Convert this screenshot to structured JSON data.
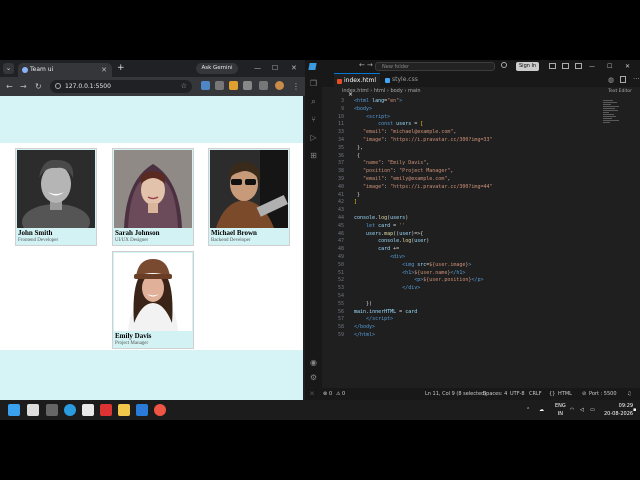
{
  "browser": {
    "tab_title": "Team ui",
    "new_tab": "+",
    "gemini_label": "Ask Gemini",
    "address": "127.0.0.1:5500",
    "minimize": "—",
    "maximize": "☐",
    "close": "✕"
  },
  "cards": [
    {
      "name": "John Smith",
      "position": "Frontend Developer"
    },
    {
      "name": "Sarah Johnson",
      "position": "UI/UX Designer"
    },
    {
      "name": "Michael Brown",
      "position": "Backend Developer"
    },
    {
      "name": "Emily Davis",
      "position": "Project Manager"
    }
  ],
  "vscode": {
    "search_placeholder": "New folder",
    "sign_in": "Sign In",
    "tabs": [
      {
        "label": "index.html",
        "close": "×"
      },
      {
        "label": "style.css"
      }
    ],
    "breadcrumb": [
      "index.html",
      "html",
      "body",
      "main"
    ],
    "text_editor_label": "Text Editor",
    "code_lines": [
      {
        "n": "3",
        "html": "<span class='tg'>&lt;html</span> <span class='at'>lang</span>=<span class='st'>\"en\"</span><span class='tg'>&gt;</span>"
      },
      {
        "n": "9",
        "html": "<span class='tg'>&lt;body&gt;</span>"
      },
      {
        "n": "10",
        "html": "    <span class='tg'>&lt;script&gt;</span>"
      },
      {
        "n": "11",
        "html": "        <span class='kw'>const</span> <span class='at'>users</span> = <span class='pu'>[</span>"
      },
      {
        "n": "33",
        "html": "   <span class='st'>\"email\"</span>: <span class='st'>\"michael@example.com\"</span>,"
      },
      {
        "n": "34",
        "html": "   <span class='st'>\"image\"</span>: <span class='st'>\"https://i.pravatar.cc/300?img=33\"</span>"
      },
      {
        "n": "35",
        "html": " },"
      },
      {
        "n": "36",
        "html": " {"
      },
      {
        "n": "37",
        "html": "   <span class='st'>\"name\"</span>: <span class='st'>\"Emily Davis\"</span>,"
      },
      {
        "n": "38",
        "html": "   <span class='st'>\"position\"</span>: <span class='st'>\"Project Manager\"</span>,"
      },
      {
        "n": "39",
        "html": "   <span class='st'>\"email\"</span>: <span class='st'>\"emily@example.com\"</span>,"
      },
      {
        "n": "40",
        "html": "   <span class='st'>\"image\"</span>: <span class='st'>\"https://i.pravatar.cc/300?img=44\"</span>"
      },
      {
        "n": "41",
        "html": " }"
      },
      {
        "n": "42",
        "html": "<span class='pu'>]</span>"
      },
      {
        "n": "43",
        "html": ""
      },
      {
        "n": "44",
        "html": "<span class='at'>console</span>.<span class='fn'>log</span>(<span class='at'>users</span>)"
      },
      {
        "n": "45",
        "html": "    <span class='kw'>let</span> <span class='at'>card</span> = <span class='st'>''</span>"
      },
      {
        "n": "46",
        "html": "    <span class='at'>users</span>.<span class='fn'>map</span>((<span class='at'>user</span>)=&gt;{"
      },
      {
        "n": "47",
        "html": "        <span class='at'>console</span>.<span class='fn'>log</span>(<span class='at'>user</span>)"
      },
      {
        "n": "48",
        "html": "        <span class='at'>card</span> +="
      },
      {
        "n": "49",
        "html": "            <span class='tg'>&lt;div&gt;</span>"
      },
      {
        "n": "50",
        "html": "                <span class='tg'>&lt;img</span> <span class='at'>src</span>=<span class='st'>${user.image}</span><span class='tg'>&gt;</span>"
      },
      {
        "n": "51",
        "html": "                <span class='tg'>&lt;h1&gt;</span><span class='st'>${user.name}</span><span class='tg'>&lt;/h1&gt;</span>"
      },
      {
        "n": "52",
        "html": "                    <span class='tg'>&lt;p&gt;</span><span class='st'>${user.position}</span><span class='tg'>&lt;/p&gt;</span>"
      },
      {
        "n": "53",
        "html": "                <span class='tg'>&lt;/div&gt;</span>"
      },
      {
        "n": "54",
        "html": ""
      },
      {
        "n": "55",
        "html": "    })"
      },
      {
        "n": "56",
        "html": "<span class='at'>main</span>.<span class='at'>innerHTML</span> = <span class='at'>card</span>"
      },
      {
        "n": "57",
        "html": "    <span class='tg'>&lt;/script&gt;</span>"
      },
      {
        "n": "58",
        "html": "<span class='tg'>&lt;/body&gt;</span>"
      },
      {
        "n": "59",
        "html": "<span class='tg'>&lt;/html&gt;</span>"
      }
    ],
    "status": {
      "errors": "0",
      "warnings": "0",
      "position": "Ln 11, Col 9 (8 selected)",
      "spaces": "Spaces: 4",
      "encoding": "UTF-8",
      "eol": "CRLF",
      "language": "HTML",
      "port": "Port : 5500"
    }
  },
  "taskbar": {
    "lang": "ENG",
    "region": "IN",
    "time": "09:29",
    "date": "20-08-2026"
  },
  "colors": {
    "page_bg": "#d6f3f6",
    "card_bg": "#d3f2f4",
    "vscode_accent": "#0078d4"
  }
}
